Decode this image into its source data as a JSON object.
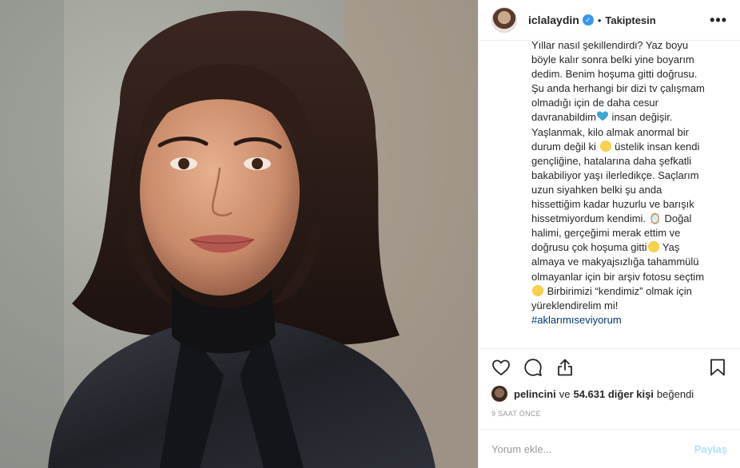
{
  "post": {
    "photo_alt": "",
    "colors": {
      "accent": "#3897f0",
      "hashtag": "#003569",
      "post_button": "#b2dffc",
      "muted": "#999999"
    }
  },
  "header": {
    "username": "iclalaydin",
    "verified_icon": "verified-badge-icon",
    "separator": "•",
    "follow_status": "Takiptesin",
    "more_icon": "more-options-icon",
    "more_glyph": "•••"
  },
  "caption": {
    "lines": [
      "Yıllar nasıl şekillendirdi? Yaz boyu",
      "böyle kalır sonra belki yine boyarım",
      "dedim. Benim hoşuma gitti doğrusu.",
      "Şu anda herhangi bir dizi tv çalışmam",
      "olmadığı için de daha cesur"
    ],
    "line6_a": "davranabildim",
    "line6_b": " insan değişir.",
    "line7": "Yaşlanmak, kilo almak anormal bir",
    "line8_a": "durum değil ki ",
    "line8_b": " üstelik insan kendi",
    "lines_b": [
      "gençliğine, hatalarına daha şefkatli",
      "bakabiliyor yaşı ilerledikçe. Saçlarım",
      "uzun siyahken belki şu anda",
      "hissettiğim kadar huzurlu ve barışık"
    ],
    "line13": "hissetmiyordum kendimi. 🪞 Doğal",
    "line14": "halimi, gerçeğimi merak ettim ve",
    "line15_a": "doğrusu çok hoşuma gitti",
    "line15_b": " Yaş",
    "line16": "almaya ve makyajsızlığa tahammülü",
    "line17": "olmayanlar için bir arşiv fotosu seçtim",
    "line18_b": " Birbirimizi “kendimiz” olmak için",
    "line19": "yüreklendirelim mi!",
    "hashtag": "#aklarımıseviyorum"
  },
  "actions": {
    "like_icon": "heart-icon",
    "comment_icon": "comment-icon",
    "share_icon": "share-icon",
    "save_icon": "bookmark-icon"
  },
  "likes": {
    "user": "pelincini",
    "connector": "ve",
    "count_text": "54.631 diğer kişi",
    "suffix": "beğendi"
  },
  "timestamp": "9 SAAT ÖNCE",
  "comment": {
    "placeholder": "Yorum ekle...",
    "post_label": "Paylaş"
  }
}
